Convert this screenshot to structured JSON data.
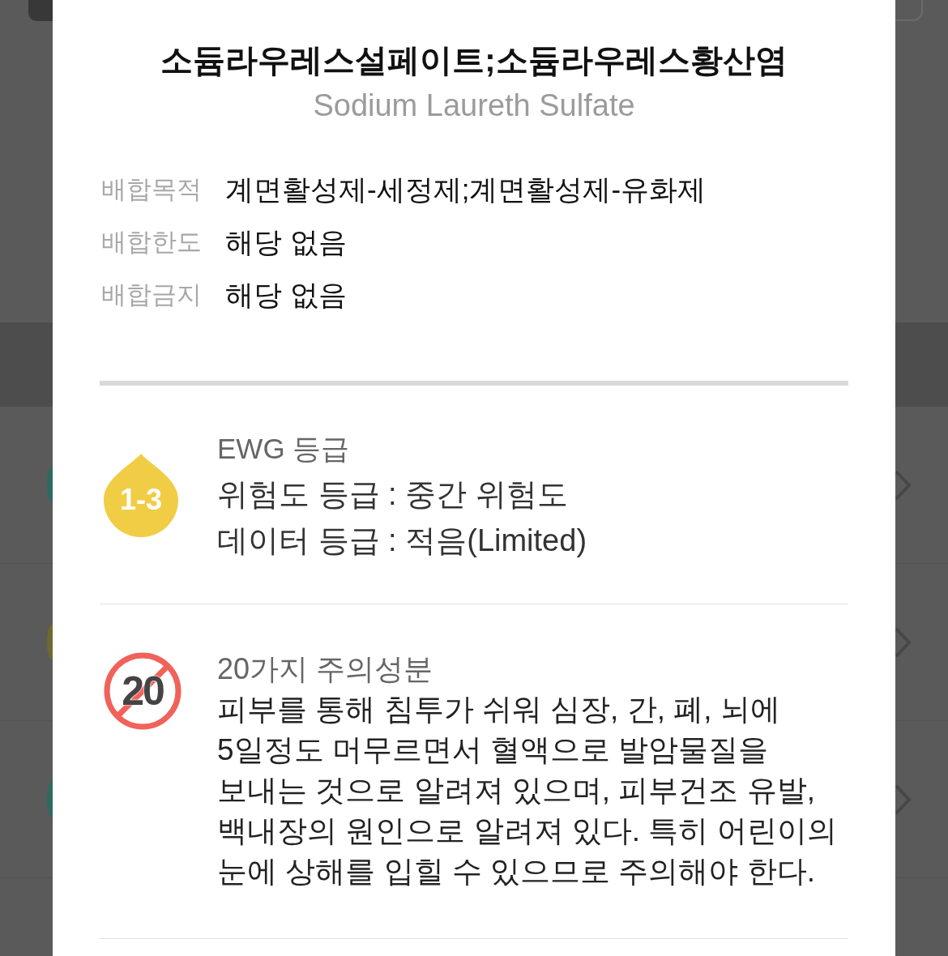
{
  "background": {
    "rows": [
      {
        "color": "#2e6a62"
      },
      {
        "color": "#6e6930"
      },
      {
        "color": "#2e6a62"
      }
    ]
  },
  "dialog": {
    "title": "소듐라우레스설페이트;소듐라우레스황산염",
    "subtitle": "Sodium Laureth Sulfate",
    "details": [
      {
        "label": "배합목적",
        "value": "계면활성제-세정제;계면활성제-유화제"
      },
      {
        "label": "배합한도",
        "value": "해당 없음"
      },
      {
        "label": "배합금지",
        "value": "해당 없음"
      }
    ],
    "sections": [
      {
        "kind": "ewg",
        "title": "EWG 등급",
        "badge": "1-3",
        "lines": [
          "위험도 등급 : 중간 위험도",
          "데이터 등급 : 적음(Limited)"
        ]
      },
      {
        "kind": "caution",
        "title": "20가지 주의성분",
        "badge": "20",
        "text": "피부를 통해 침투가 쉬워 심장, 간, 폐, 뇌에 5일정도 머무르면서 혈액으로 발암물질을 보내는 것으로 알려져 있으며, 피부건조 유발, 백내장의 원인으로 알려져 있다. 특히 어린이의 눈에 상해를 입힐 수 있으므로 주의해야 한다."
      }
    ]
  }
}
